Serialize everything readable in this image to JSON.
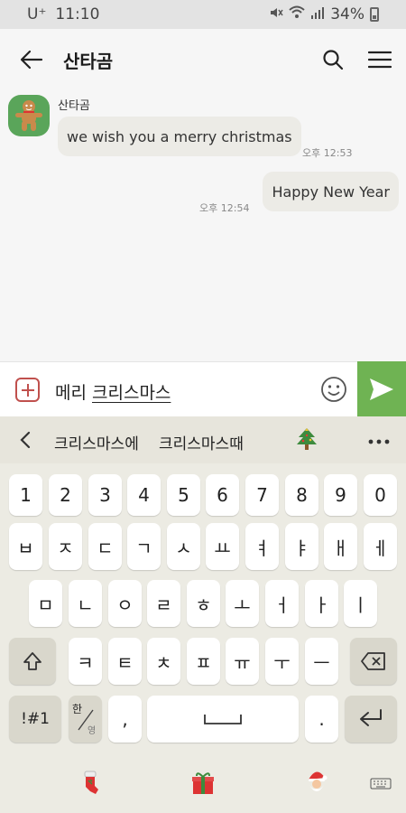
{
  "status_bar": {
    "carrier": "U⁺",
    "time": "11:10",
    "battery": "34%"
  },
  "header": {
    "title": "산타곰"
  },
  "chat": {
    "messages": [
      {
        "direction": "in",
        "sender": "산타곰",
        "text": "we wish you a merry christmas",
        "time": "오후 12:53"
      },
      {
        "direction": "out",
        "text": "Happy New Year",
        "time": "오후 12:54"
      }
    ]
  },
  "input": {
    "committed_text": "메리 ",
    "composing_text": "크리스마스"
  },
  "suggestions": {
    "items": [
      "크리스마스에",
      "크리스마스때"
    ],
    "emoji": "christmas-tree"
  },
  "keyboard": {
    "row1": [
      "1",
      "2",
      "3",
      "4",
      "5",
      "6",
      "7",
      "8",
      "9",
      "0"
    ],
    "row2": [
      "ㅂ",
      "ㅈ",
      "ㄷ",
      "ㄱ",
      "ㅅ",
      "ㅛ",
      "ㅕ",
      "ㅑ",
      "ㅐ",
      "ㅔ"
    ],
    "row3": [
      "ㅁ",
      "ㄴ",
      "ㅇ",
      "ㄹ",
      "ㅎ",
      "ㅗ",
      "ㅓ",
      "ㅏ",
      "ㅣ"
    ],
    "row4": [
      "ㅋ",
      "ㅌ",
      "ㅊ",
      "ㅍ",
      "ㅠ",
      "ㅜ",
      "ㅡ"
    ],
    "symbols_label": "!#1",
    "lang_top": "한",
    "lang_bottom": "영",
    "comma": ",",
    "period": "."
  },
  "colors": {
    "send_button": "#6fb353",
    "plus_border": "#c0504d",
    "bubble": "#ecebe6"
  }
}
